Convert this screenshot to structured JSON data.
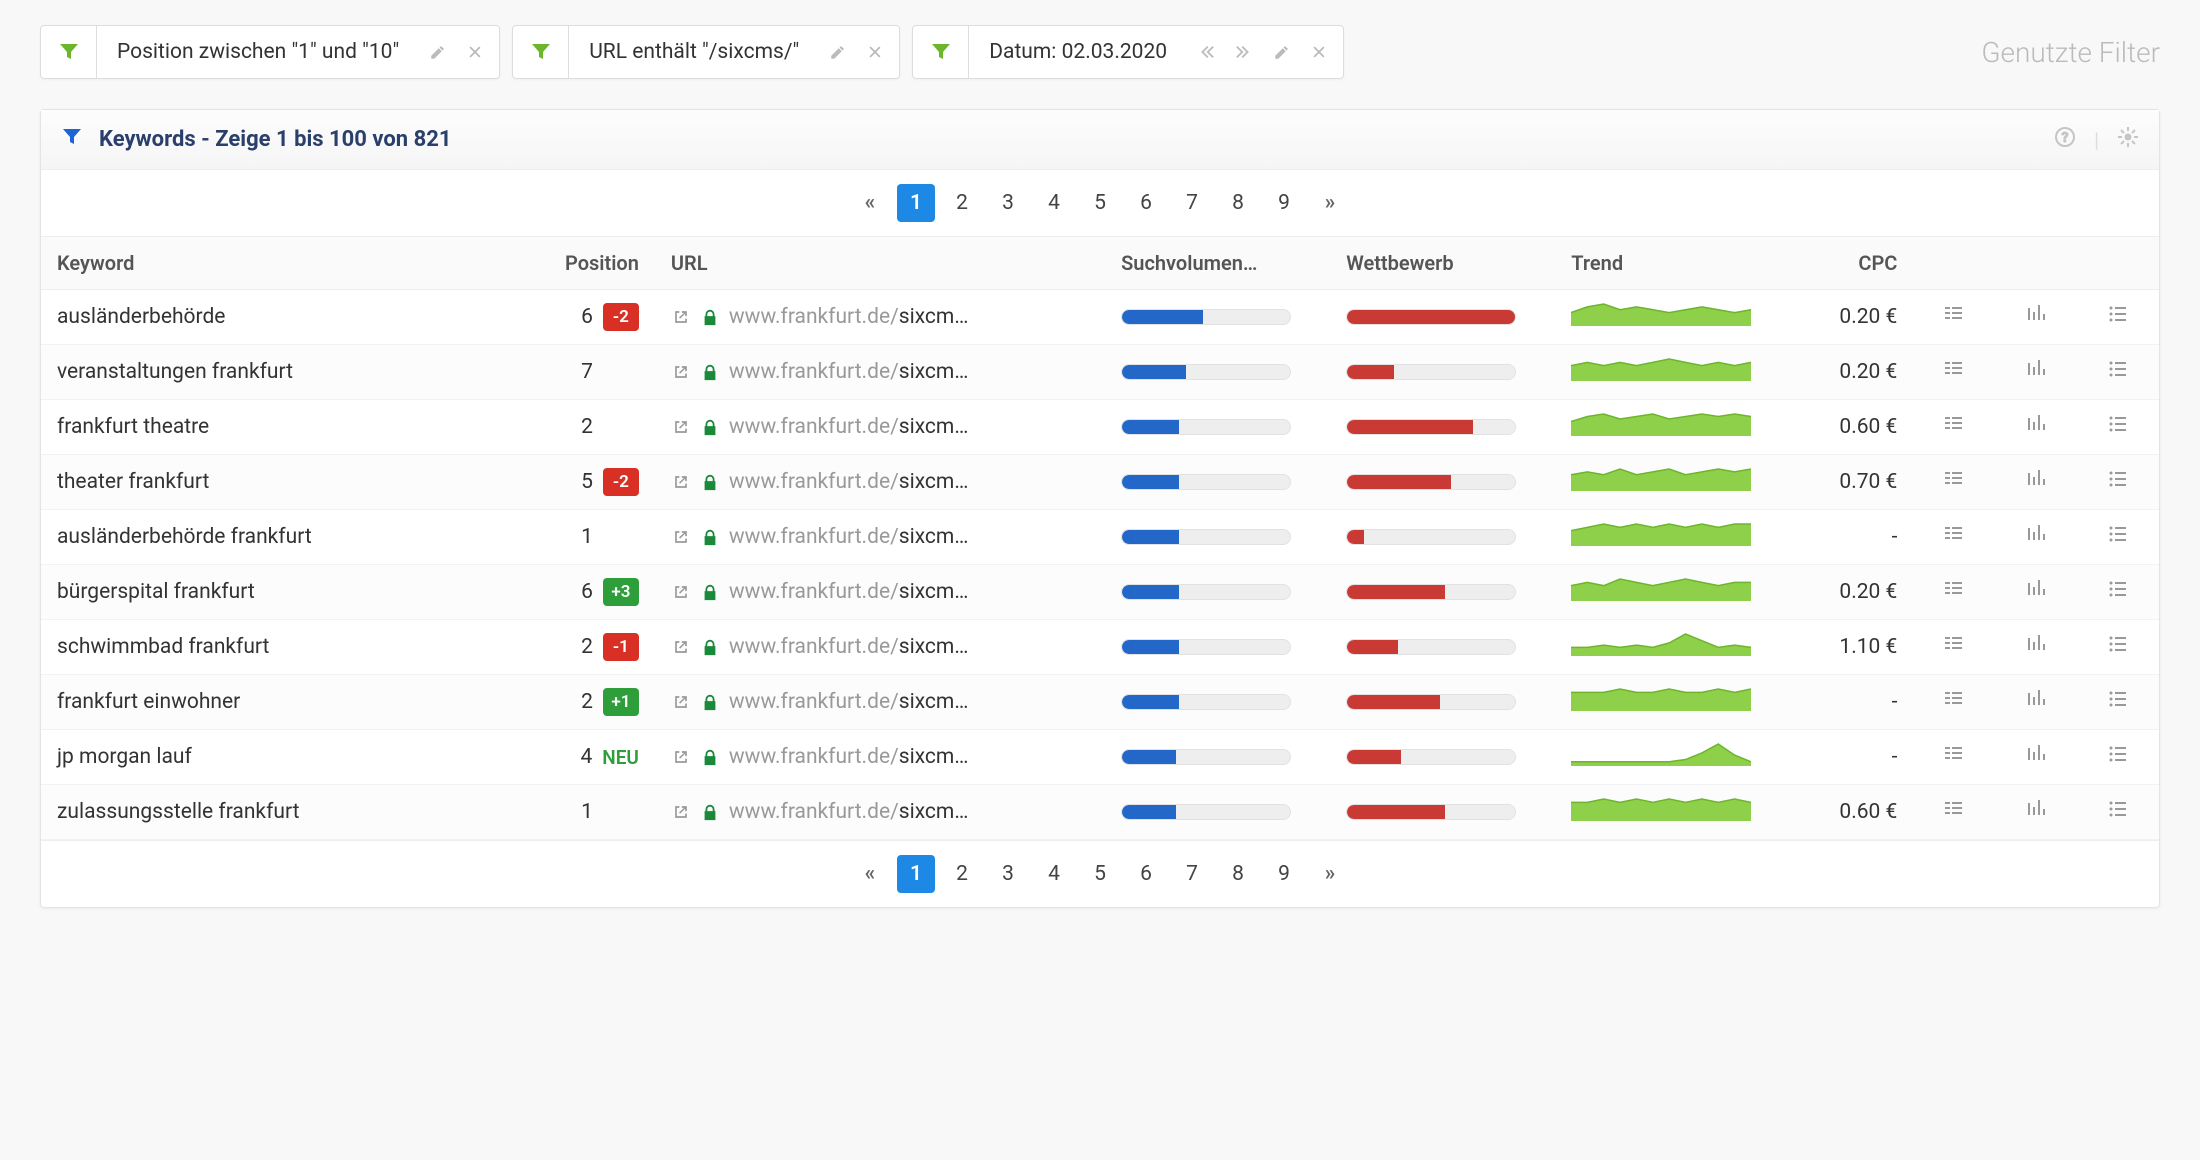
{
  "filters_label": "Genutzte Filter",
  "filters": [
    {
      "label": "Position zwischen \"1\" und \"10\"",
      "type": "filter",
      "edit": true,
      "remove": true
    },
    {
      "label": "URL enthält \"/sixcms/\"",
      "type": "filter",
      "edit": true,
      "remove": true
    },
    {
      "label": "Datum: 02.03.2020",
      "type": "date",
      "prev": true,
      "next": true,
      "edit": true,
      "remove": true
    }
  ],
  "panel": {
    "title": "Keywords - Zeige 1 bis 100 von 821"
  },
  "pagination": {
    "active": 1,
    "pages": [
      "1",
      "2",
      "3",
      "4",
      "5",
      "6",
      "7",
      "8",
      "9"
    ]
  },
  "columns": {
    "keyword": "Keyword",
    "position": "Position",
    "url": "URL",
    "volume": "Suchvolumen…",
    "competition": "Wettbewerb",
    "trend": "Trend",
    "cpc": "CPC"
  },
  "url_domain": "www.frankfurt.de/",
  "url_path_display": "sixcm…",
  "rows": [
    {
      "keyword": "ausländerbehörde",
      "position": "6",
      "change": "-2",
      "change_type": "red",
      "volume": 48,
      "competition": 100,
      "trend": [
        4,
        6,
        7,
        5,
        6,
        5,
        4,
        5,
        6,
        5,
        4,
        5
      ],
      "cpc": "0.20 €"
    },
    {
      "keyword": "veranstaltungen frankfurt",
      "position": "7",
      "change": "",
      "change_type": "",
      "volume": 38,
      "competition": 28,
      "trend": [
        4,
        5,
        4,
        5,
        4,
        5,
        6,
        5,
        4,
        5,
        4,
        5
      ],
      "cpc": "0.20 €"
    },
    {
      "keyword": "frankfurt theatre",
      "position": "2",
      "change": "",
      "change_type": "",
      "volume": 34,
      "competition": 75,
      "trend": [
        5,
        7,
        8,
        6,
        7,
        8,
        6,
        7,
        8,
        7,
        8,
        7
      ],
      "cpc": "0.60 €"
    },
    {
      "keyword": "theater frankfurt",
      "position": "5",
      "change": "-2",
      "change_type": "red",
      "volume": 34,
      "competition": 62,
      "trend": [
        5,
        6,
        5,
        7,
        5,
        6,
        7,
        5,
        6,
        7,
        6,
        7
      ],
      "cpc": "0.70 €"
    },
    {
      "keyword": "ausländerbehörde frankfurt",
      "position": "1",
      "change": "",
      "change_type": "",
      "volume": 34,
      "competition": 10,
      "trend": [
        4,
        5,
        6,
        5,
        6,
        5,
        6,
        5,
        6,
        5,
        6,
        6
      ],
      "cpc": "-"
    },
    {
      "keyword": "bürgerspital frankfurt",
      "position": "6",
      "change": "+3",
      "change_type": "green",
      "volume": 34,
      "competition": 58,
      "trend": [
        4,
        5,
        4,
        6,
        5,
        4,
        5,
        6,
        5,
        4,
        5,
        5
      ],
      "cpc": "0.20 €"
    },
    {
      "keyword": "schwimmbad frankfurt",
      "position": "2",
      "change": "-1",
      "change_type": "red",
      "volume": 34,
      "competition": 30,
      "trend": [
        3,
        3,
        4,
        3,
        4,
        3,
        5,
        9,
        6,
        3,
        4,
        3
      ],
      "cpc": "1.10 €"
    },
    {
      "keyword": "frankfurt einwohner",
      "position": "2",
      "change": "+1",
      "change_type": "green",
      "volume": 34,
      "competition": 55,
      "trend": [
        5,
        5,
        5,
        6,
        5,
        5,
        6,
        5,
        5,
        6,
        5,
        6
      ],
      "cpc": "-"
    },
    {
      "keyword": "jp morgan lauf",
      "position": "4",
      "change": "NEU",
      "change_type": "neu",
      "volume": 32,
      "competition": 32,
      "trend": [
        1,
        1,
        1,
        1,
        1,
        1,
        1,
        2,
        5,
        9,
        4,
        1
      ],
      "cpc": "-"
    },
    {
      "keyword": "zulassungsstelle frankfurt",
      "position": "1",
      "change": "",
      "change_type": "",
      "volume": 32,
      "competition": 58,
      "trend": [
        5,
        5,
        6,
        5,
        6,
        5,
        6,
        5,
        6,
        5,
        6,
        5
      ],
      "cpc": "0.60 €"
    }
  ]
}
